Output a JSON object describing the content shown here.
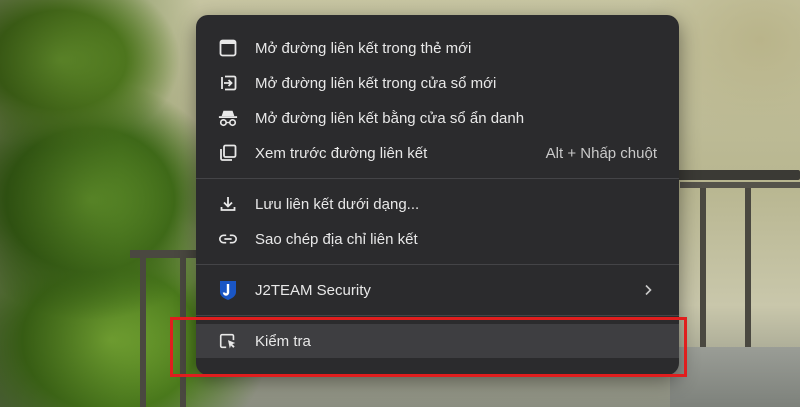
{
  "menu": {
    "items": [
      {
        "id": "open-new-tab",
        "label": "Mở đường liên kết trong thẻ mới",
        "icon": "new-tab-icon"
      },
      {
        "id": "open-new-window",
        "label": "Mở đường liên kết trong cửa sổ mới",
        "icon": "new-window-icon"
      },
      {
        "id": "open-incognito",
        "label": "Mở đường liên kết bằng cửa sổ ẩn danh",
        "icon": "incognito-icon"
      },
      {
        "id": "preview-link",
        "label": "Xem trước đường liên kết",
        "shortcut": "Alt + Nhấp chuột",
        "icon": "preview-icon"
      },
      {
        "id": "save-link-as",
        "label": "Lưu liên kết dưới dạng...",
        "icon": "download-icon"
      },
      {
        "id": "copy-link",
        "label": "Sao chép địa chỉ liên kết",
        "icon": "link-icon"
      },
      {
        "id": "j2team",
        "label": "J2TEAM Security",
        "icon": "j2team-shield-icon",
        "has_submenu": true
      },
      {
        "id": "inspect",
        "label": "Kiểm tra",
        "icon": "inspect-icon",
        "hovered": true
      }
    ]
  },
  "colors": {
    "menu_bg": "#2b2b2d",
    "hover_bg": "#3e3e41",
    "highlight_border": "#e01e1e",
    "j2team_blue": "#1a56c5"
  }
}
